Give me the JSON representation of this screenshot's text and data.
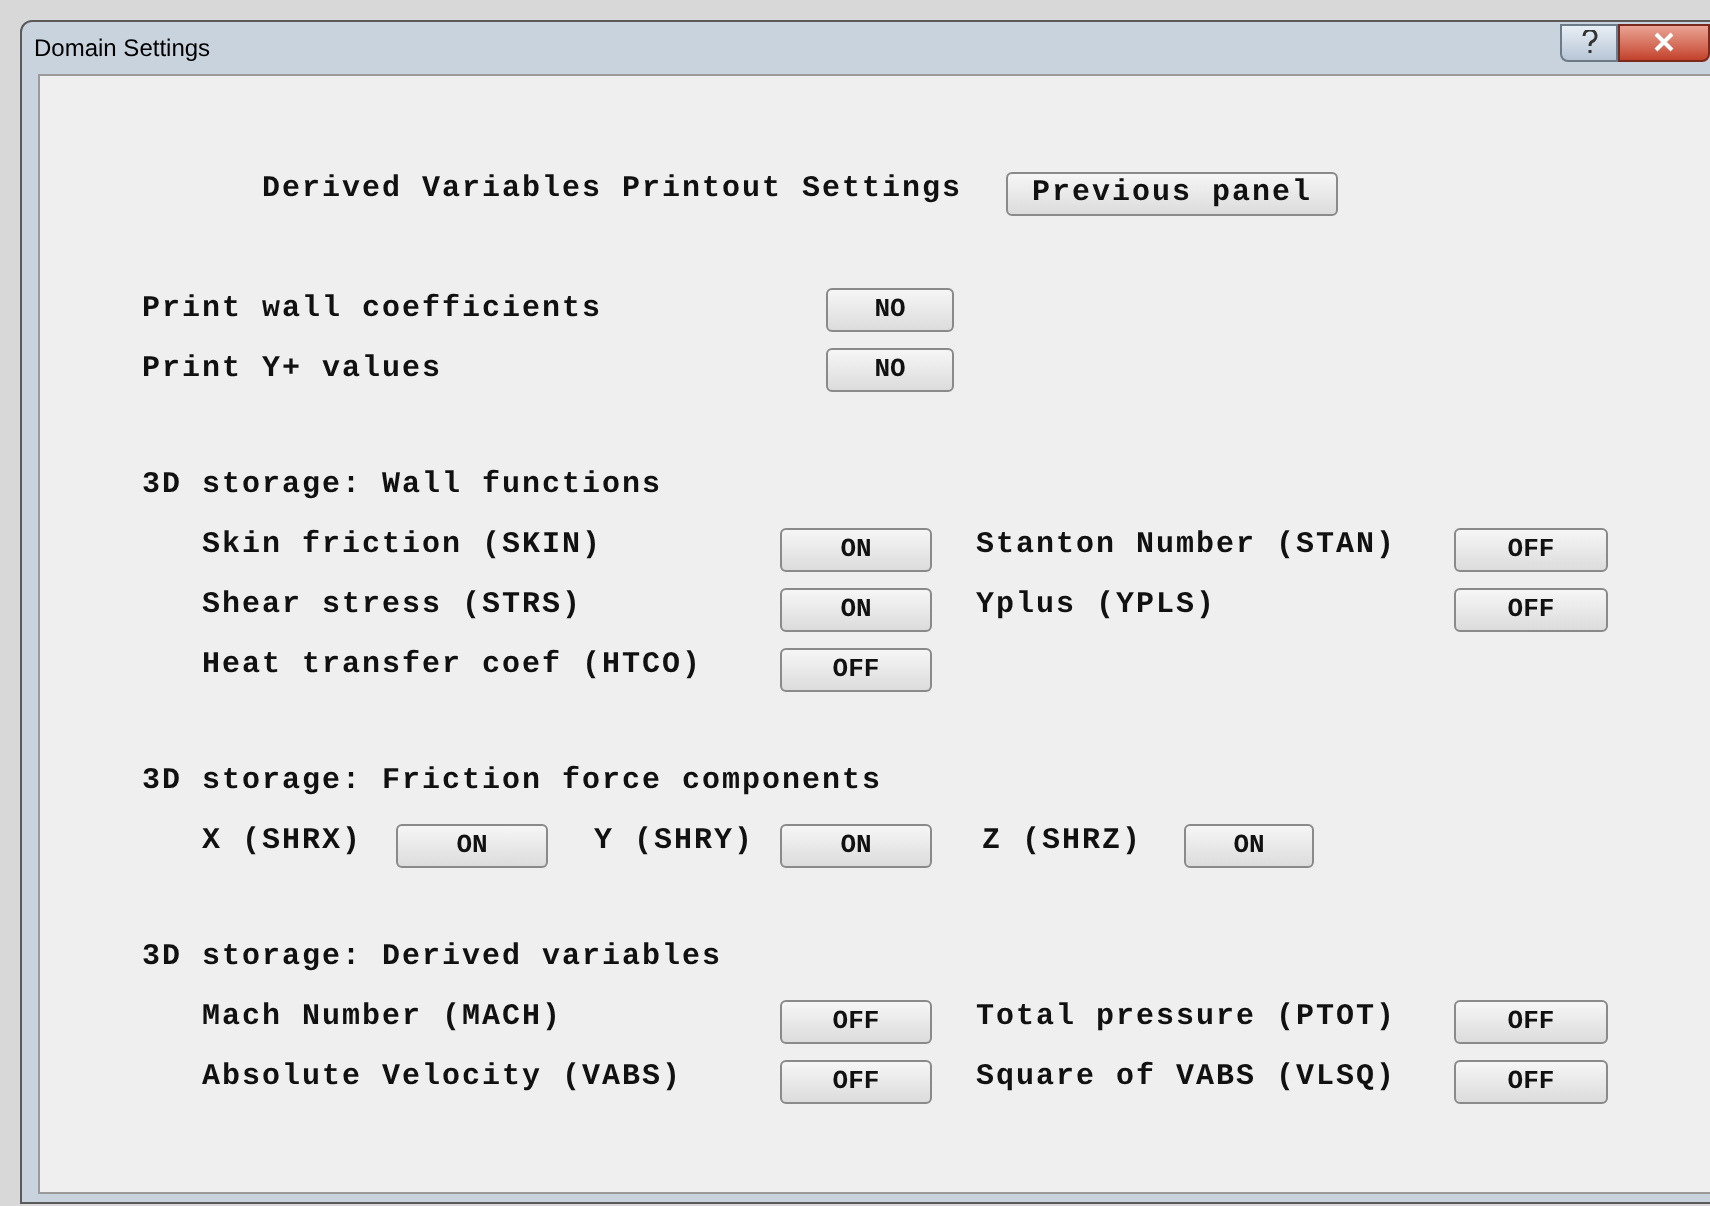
{
  "window": {
    "title": "Domain Settings"
  },
  "heading": "Derived Variables Printout Settings",
  "previous_button": "Previous panel",
  "print_options": [
    {
      "label": "Print wall coefficients",
      "value": "NO"
    },
    {
      "label": "Print Y+ values",
      "value": "NO"
    }
  ],
  "sections": [
    {
      "kind": "grid",
      "title": "3D storage: Wall functions",
      "rows": [
        [
          {
            "label": "Skin friction (SKIN)",
            "value": "ON"
          },
          {
            "label": "Stanton Number (STAN)",
            "value": "OFF"
          }
        ],
        [
          {
            "label": "Shear stress (STRS)",
            "value": "ON"
          },
          {
            "label": "Yplus (YPLS)",
            "value": "OFF"
          }
        ],
        [
          {
            "label": "Heat transfer coef (HTCO)",
            "value": "OFF"
          }
        ]
      ]
    },
    {
      "kind": "inline",
      "title": "3D storage: Friction force components",
      "rows": [
        [
          {
            "label": "X (SHRX)",
            "value": "ON"
          },
          {
            "label": "Y (SHRY)",
            "value": "ON"
          },
          {
            "label": "Z (SHRZ)",
            "value": "ON"
          }
        ]
      ]
    },
    {
      "kind": "grid",
      "title": "3D storage: Derived variables",
      "rows": [
        [
          {
            "label": "Mach Number (MACH)",
            "value": "OFF"
          },
          {
            "label": "Total pressure (PTOT)",
            "value": "OFF"
          }
        ],
        [
          {
            "label": "Absolute Velocity (VABS)",
            "value": "OFF"
          },
          {
            "label": "Square of VABS (VLSQ)",
            "value": "OFF"
          }
        ]
      ]
    }
  ]
}
